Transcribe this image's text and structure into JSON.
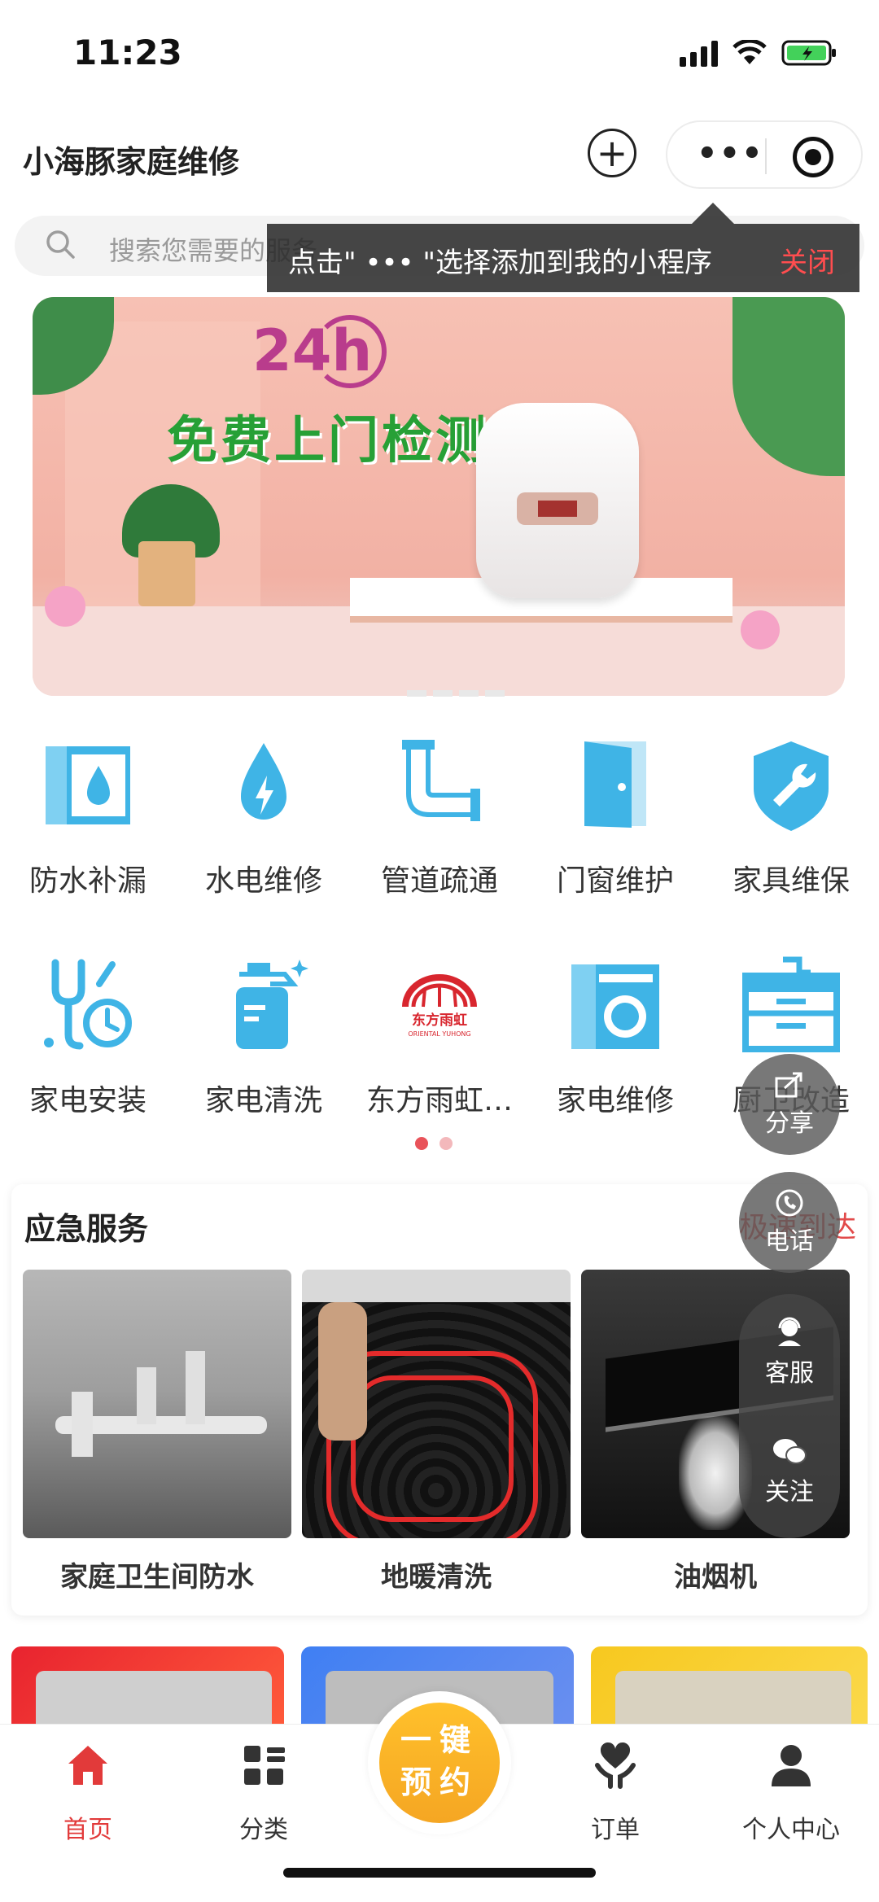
{
  "status_bar": {
    "time": "11:23"
  },
  "header": {
    "title": "小海豚家庭维修"
  },
  "search": {
    "placeholder": "搜索您需要的服务"
  },
  "tip": {
    "text": "点击\" ••• \"选择添加到我的小程序",
    "close_label": "关闭"
  },
  "banner": {
    "badge": "24h",
    "slogan": "免费上门检测"
  },
  "categories": [
    {
      "label": "防水补漏",
      "icon": "waterproof-icon"
    },
    {
      "label": "水电维修",
      "icon": "water-electric-icon"
    },
    {
      "label": "管道疏通",
      "icon": "pipe-icon"
    },
    {
      "label": "门窗维护",
      "icon": "door-icon"
    },
    {
      "label": "家具维保",
      "icon": "wrench-shield-icon"
    },
    {
      "label": "家电安装",
      "icon": "tools-clock-icon"
    },
    {
      "label": "家电清洗",
      "icon": "spray-bottle-icon"
    },
    {
      "label": "东方雨虹…",
      "icon": "oriental-yuhong-logo",
      "logo_cn": "东方雨虹",
      "logo_en": "ORIENTAL YUHONG"
    },
    {
      "label": "家电维修",
      "icon": "washing-machine-icon"
    },
    {
      "label": "厨卫改造",
      "icon": "sink-cabinet-icon"
    }
  ],
  "emergency": {
    "title": "应急服务",
    "more": "极速到达",
    "items": [
      {
        "name": "家庭卫生间防水"
      },
      {
        "name": "地暖清洗"
      },
      {
        "name": "油烟机"
      }
    ]
  },
  "floating": {
    "share": "分享",
    "phone": "电话",
    "service": "客服",
    "follow": "关注"
  },
  "tabbar": {
    "home": "首页",
    "category": "分类",
    "book_line1": "一键",
    "book_line2": "预约",
    "orders": "订单",
    "profile": "个人中心"
  },
  "colors": {
    "accent": "#e23a3a",
    "icon_blue": "#3fb4e6",
    "book_yellow": "#f7ae22"
  }
}
